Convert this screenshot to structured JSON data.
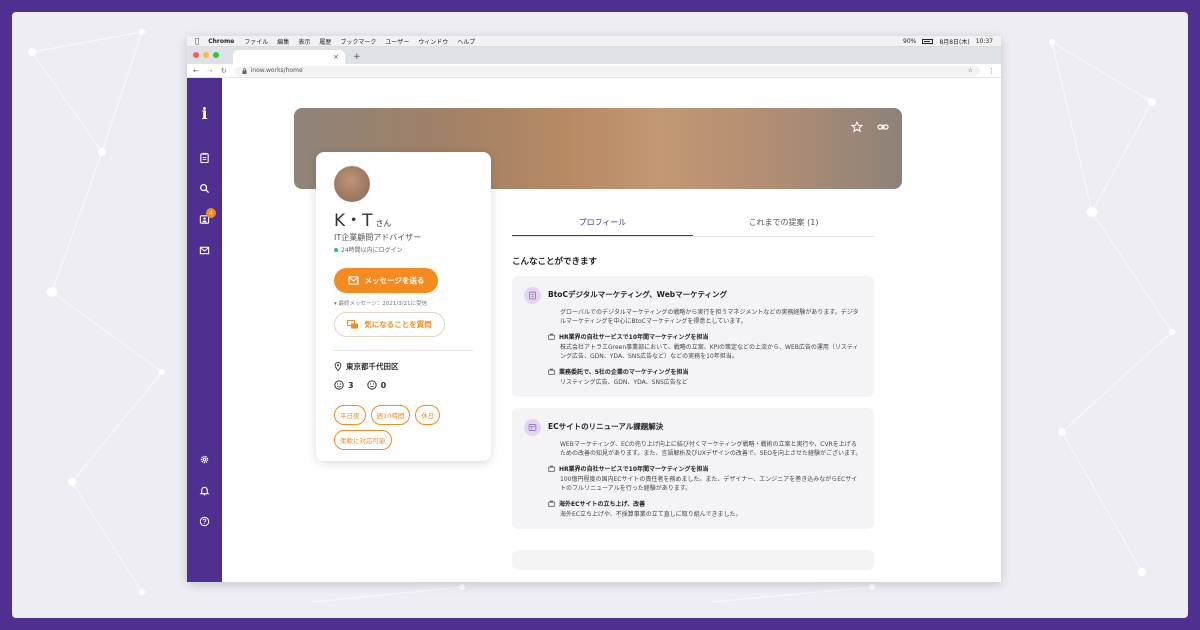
{
  "menubar": {
    "app": "Chrome",
    "items": [
      "ファイル",
      "編集",
      "表示",
      "履歴",
      "ブックマーク",
      "ユーザー",
      "ウィンドウ",
      "ヘルプ"
    ],
    "battery": "90%",
    "date": "8月8日(木)",
    "time": "10:37"
  },
  "browser": {
    "tab_close": "×",
    "new_tab": "+",
    "url": "inow.works/home"
  },
  "sidebar": {
    "logo": "i",
    "inbox_badge": "4"
  },
  "profile": {
    "name": "K・T",
    "honorific": "さん",
    "role": "IT企業顧問アドバイザー",
    "online_status": "24時間以内にログイン",
    "message_button": "メッセージを送る",
    "last_message": "最終メッセージ：2021/3/21に受信",
    "question_button": "気になることを質問",
    "location": "東京都千代田区",
    "positive_count": "3",
    "neutral_count": "0",
    "tags": [
      "平日夜",
      "週10時間",
      "休日",
      "柔軟に対応可能"
    ]
  },
  "tabs": {
    "profile": "プロフィール",
    "proposals": "これまでの提案 (1)"
  },
  "main": {
    "section_title": "こんなことができます",
    "cards": [
      {
        "title": "BtoCデジタルマーケティング、Webマーケティング",
        "description": "グローバルでのデジタルマーケティングの戦略から実行を担うマネジメントなどの実務経験があります。デジタルマーケティングを中心にBtoCマーケティングを得意としています。",
        "items": [
          {
            "title": "HR業界の自社サービスで10年間マーケティングを担当",
            "text": "株式会社アトラエGreen事業部において、戦略の立案、KPIの策定などの上流から、WEB広告の運用（リスティング広告、GDN、YDA、SNS広告など）などの実務を10年担当。"
          },
          {
            "title": "業務委託で、5社の企業のマーケティングを担当",
            "text": "リスティング広告、GDN、YDA、SNS広告など"
          }
        ]
      },
      {
        "title": "ECサイトのリニューアル課題解決",
        "description": "WEBマーケティング、ECの売り上げ向上に結び付くマーケティング戦略・戦術の立案と実行や、CVRを上げるための改善の知見があります。また、言語解析及びUXデザインの改善で、SEOを向上させた経験がございます。",
        "items": [
          {
            "title": "HR業界の自社サービスで10年間マーケティングを担当",
            "text": "100億円程度の国内ECサイトの責任者を務めました。また、デザイナー、エンジニアを巻き込みながらECサイトのフルリニューアルを行った経験があります。"
          },
          {
            "title": "海外ECサイトの立ち上げ、改善",
            "text": "海外EC立ち上げや、不採算事業の立て直しに取り組んできました。"
          }
        ]
      }
    ]
  },
  "colors": {
    "brand_purple": "#4f2f8f",
    "accent_orange": "#f58a1f",
    "online_green": "#27b9a5"
  }
}
